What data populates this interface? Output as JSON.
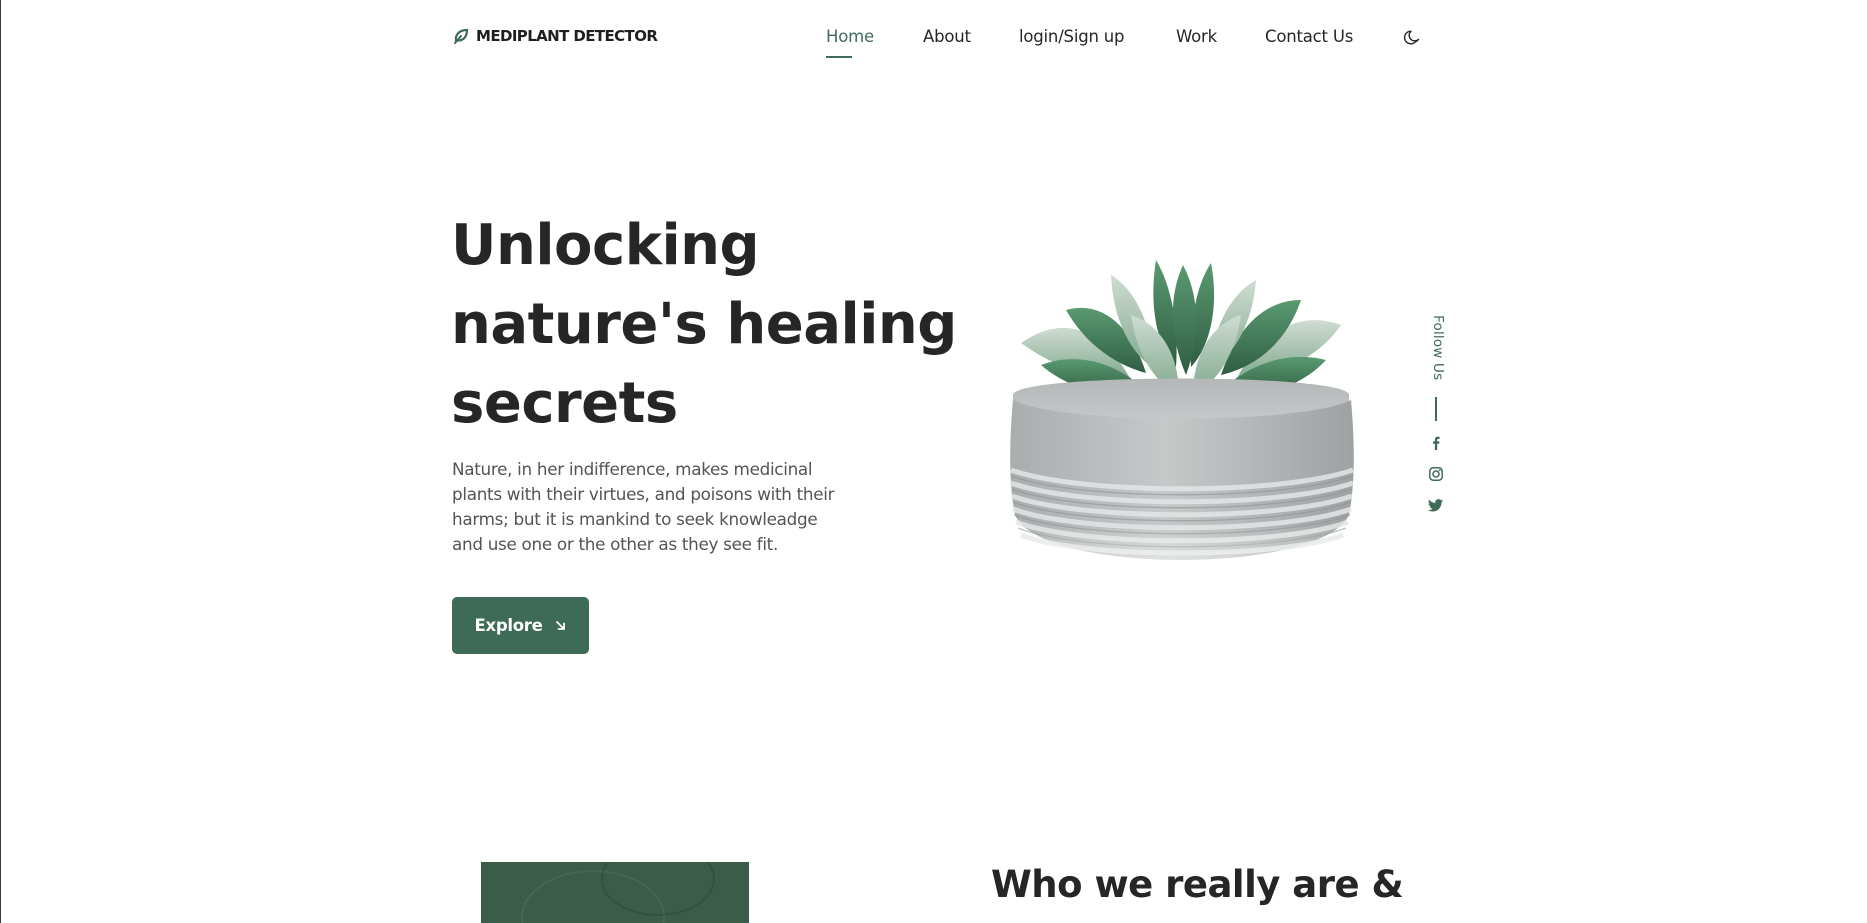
{
  "brand": {
    "name": "MEDIPLANT DETECTOR",
    "icon": "leaf-icon",
    "color": "#3e6a58"
  },
  "nav": {
    "items": [
      {
        "label": "Home",
        "active": true
      },
      {
        "label": "About",
        "active": false
      },
      {
        "label": "login/Sign up",
        "active": false
      },
      {
        "label": "Work",
        "active": false
      },
      {
        "label": "Contact Us",
        "active": false
      }
    ],
    "theme_toggle_icon": "moon-icon"
  },
  "hero": {
    "title": "Unlocking nature's healing secrets",
    "description": "Nature, in her indifference, makes medicinal plants with their virtues, and poisons with their harms; but it is mankind to seek knowleadge and use one or the other as they see fit.",
    "button_label": "Explore",
    "button_icon": "arrow-down-right-icon",
    "image_subject": "succulent-in-concrete-pot"
  },
  "social": {
    "label": "Follow Us",
    "links": [
      {
        "icon": "facebook-icon"
      },
      {
        "icon": "instagram-icon"
      },
      {
        "icon": "twitter-icon"
      }
    ]
  },
  "about": {
    "heading": "Who we really are &"
  },
  "colors": {
    "accent": "#3e6a58",
    "text": "#262626",
    "muted": "#545454",
    "background": "#ffffff"
  }
}
